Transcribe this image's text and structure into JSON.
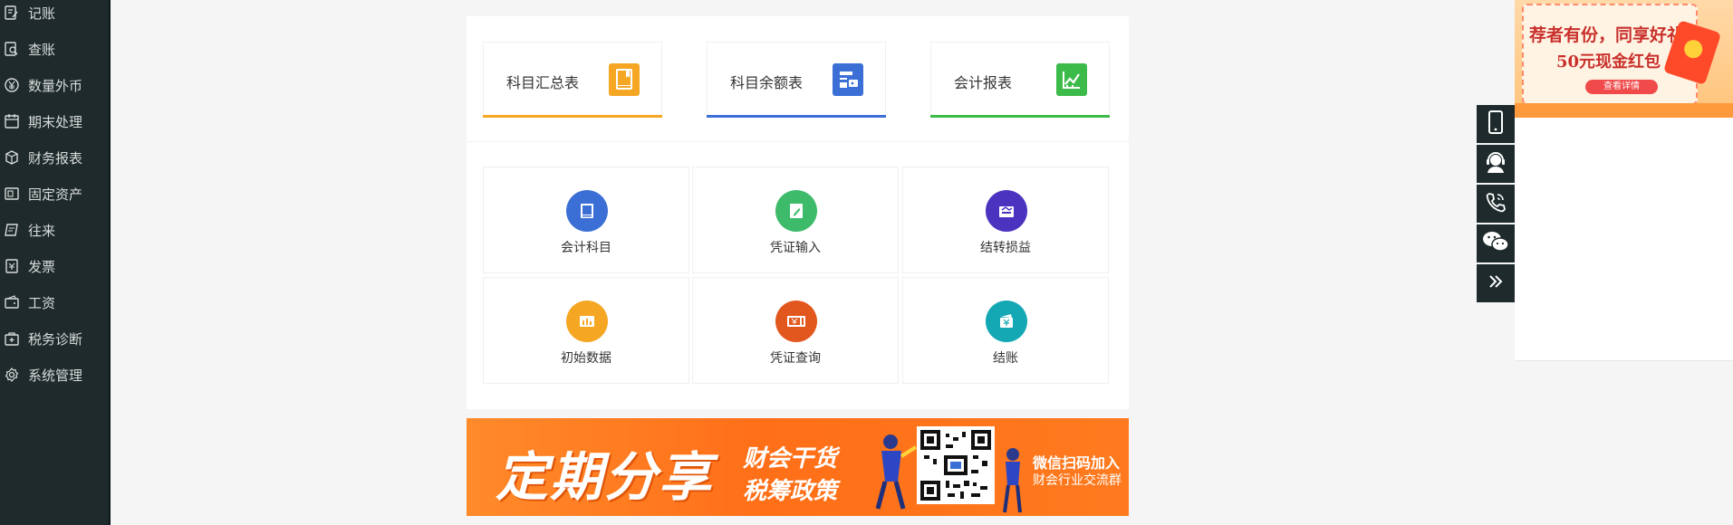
{
  "sidebar": {
    "items": [
      {
        "label": "记账",
        "icon": "edit-icon"
      },
      {
        "label": "查账",
        "icon": "search-doc-icon"
      },
      {
        "label": "数量外币",
        "icon": "currency-icon"
      },
      {
        "label": "期末处理",
        "icon": "calendar-icon"
      },
      {
        "label": "财务报表",
        "icon": "box-icon"
      },
      {
        "label": "固定资产",
        "icon": "asset-icon"
      },
      {
        "label": "往来",
        "icon": "ledger-icon"
      },
      {
        "label": "发票",
        "icon": "invoice-icon"
      },
      {
        "label": "工资",
        "icon": "wallet-icon"
      },
      {
        "label": "税务诊断",
        "icon": "medkit-icon"
      },
      {
        "label": "系统管理",
        "icon": "gear-icon"
      }
    ]
  },
  "report_tabs": [
    {
      "label": "科目汇总表",
      "color": "#f5a623",
      "icon": "book-icon"
    },
    {
      "label": "科目余额表",
      "color": "#3b6fd6",
      "icon": "wallet-icon"
    },
    {
      "label": "会计报表",
      "color": "#3dbb4a",
      "icon": "chart-icon"
    }
  ],
  "tiles": [
    {
      "label": "会计科目",
      "color": "#3b6fd6",
      "icon": "book-icon"
    },
    {
      "label": "凭证输入",
      "color": "#3dbb6a",
      "icon": "pencil-doc-icon"
    },
    {
      "label": "结转损益",
      "color": "#4b33c0",
      "icon": "transfer-icon"
    },
    {
      "label": "初始数据",
      "color": "#f5a623",
      "icon": "bar-data-icon"
    },
    {
      "label": "凭证查询",
      "color": "#e2571e",
      "icon": "voucher-icon"
    },
    {
      "label": "结账",
      "color": "#14a8b4",
      "icon": "checkout-icon"
    }
  ],
  "banner": {
    "headline": "定期分享",
    "line1": "财会干货",
    "line2": "税筹政策",
    "scan_title": "微信扫码加入",
    "scan_sub": "财会行业交流群"
  },
  "float_bar": [
    "mobile-icon",
    "customer-service-icon",
    "phone-icon",
    "wechat-icon",
    "collapse-icon"
  ],
  "ad": {
    "line1": "荐者有份，同享好礼",
    "line2": "50元现金红包",
    "cta": "查看详情"
  }
}
